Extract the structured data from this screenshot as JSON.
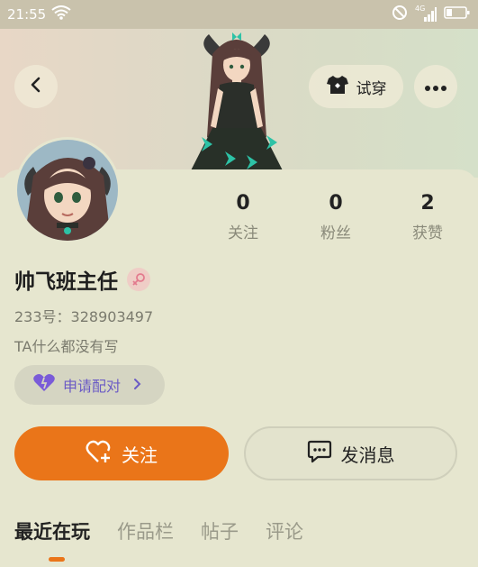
{
  "status_bar": {
    "time": "21:55",
    "network": "4G",
    "icons": [
      "wifi-icon",
      "do-not-disturb-icon",
      "signal-icon",
      "battery-icon"
    ]
  },
  "header": {
    "back_icon": "chevron-left-icon",
    "tryon_label": "试穿",
    "tryon_icon": "shirt-icon",
    "more_icon": "more-dots-icon"
  },
  "profile": {
    "username": "帅飞班主任",
    "gender": "female",
    "uid": "233号：328903497",
    "bio": "TA什么都没有写"
  },
  "stats": [
    {
      "value": "0",
      "label": "关注"
    },
    {
      "value": "0",
      "label": "粉丝"
    },
    {
      "value": "2",
      "label": "获赞"
    }
  ],
  "pair_button": {
    "label": "申请配对",
    "icon": "heart-icon"
  },
  "actions": {
    "follow_label": "关注",
    "message_label": "发消息"
  },
  "tabs": [
    {
      "label": "最近在玩",
      "active": true
    },
    {
      "label": "作品栏",
      "active": false
    },
    {
      "label": "帖子",
      "active": false
    },
    {
      "label": "评论",
      "active": false
    }
  ],
  "colors": {
    "accent": "#ea7519",
    "pair_text": "#6b5bc5",
    "background": "#e6e6cf"
  }
}
